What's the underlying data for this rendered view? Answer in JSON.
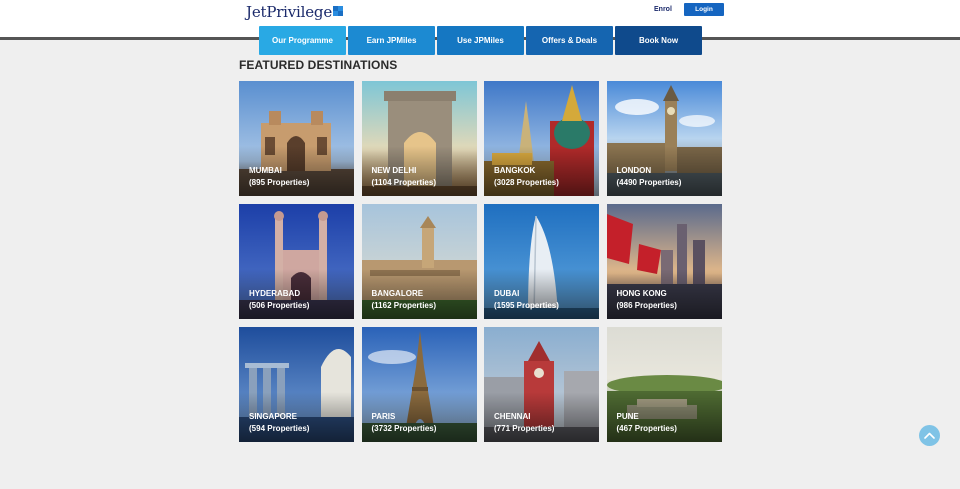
{
  "header": {
    "logo_text": "JetPrivilege",
    "enrol_label": "Enrol",
    "login_label": "Login"
  },
  "nav": {
    "items": [
      "Our Programme",
      "Earn JPMiles",
      "Use JPMiles",
      "Offers & Deals",
      "Book Now"
    ]
  },
  "main": {
    "section_title": "FEATURED DESTINATIONS",
    "destinations": [
      {
        "city": "MUMBAI",
        "properties": "(895 Properties)"
      },
      {
        "city": "NEW DELHI",
        "properties": "(1104 Properties)"
      },
      {
        "city": "BANGKOK",
        "properties": "(3028 Properties)"
      },
      {
        "city": "LONDON",
        "properties": "(4490 Properties)"
      },
      {
        "city": "HYDERABAD",
        "properties": "(506 Properties)"
      },
      {
        "city": "BANGALORE",
        "properties": "(1162 Properties)"
      },
      {
        "city": "DUBAI",
        "properties": "(1595 Properties)"
      },
      {
        "city": "HONG KONG",
        "properties": "(986 Properties)"
      },
      {
        "city": "SINGAPORE",
        "properties": "(594 Properties)"
      },
      {
        "city": "PARIS",
        "properties": "(3732 Properties)"
      },
      {
        "city": "CHENNAI",
        "properties": "(771 Properties)"
      },
      {
        "city": "PUNE",
        "properties": "(467 Properties)"
      }
    ]
  },
  "icons": {
    "logo_mark": "jetprivilege-logo-icon",
    "scroll_top": "chevron-up-icon"
  },
  "colors": {
    "brand_navy": "#1b2a6b",
    "login_blue": "#1565c0",
    "nav_light": "#29a9e4",
    "nav_dark": "#0f4a8c",
    "scroll_top": "#7fc3e6"
  }
}
